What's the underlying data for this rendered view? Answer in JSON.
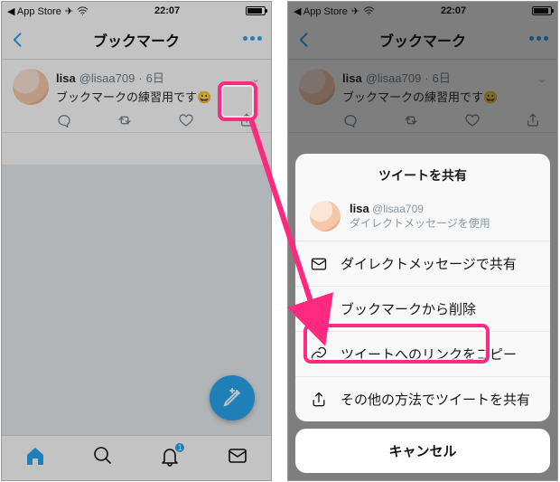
{
  "status": {
    "back_app": "App Store",
    "plane": "✈︎",
    "wifi": "wifi",
    "time": "22:07"
  },
  "nav": {
    "title": "ブックマーク"
  },
  "tweet": {
    "name": "lisa",
    "handle": "@lisaa709",
    "sep": "·",
    "age": "6日",
    "text": "ブックマークの練習用です",
    "emoji": "😀"
  },
  "tabs": {
    "notif_badge": "1"
  },
  "sheet": {
    "title": "ツイートを共有",
    "user_name": "lisa",
    "user_handle": "@lisaa709",
    "user_sub": "ダイレクトメッセージを使用",
    "dm": "ダイレクトメッセージで共有",
    "remove": "ブックマークから削除",
    "copy": "ツイートへのリンクをコピー",
    "other": "その他の方法でツイートを共有",
    "cancel": "キャンセル"
  }
}
